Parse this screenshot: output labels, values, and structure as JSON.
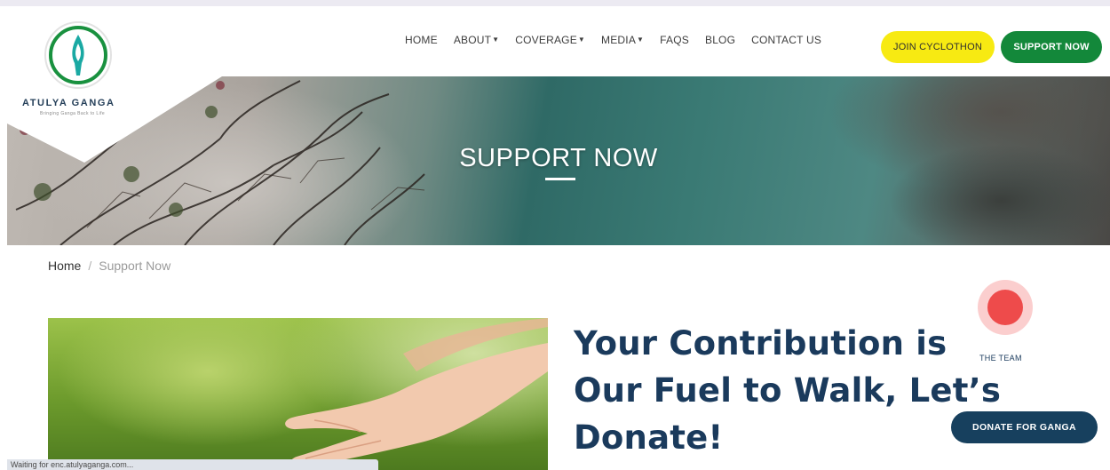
{
  "nav": {
    "items": [
      {
        "label": "HOME",
        "has_dropdown": false
      },
      {
        "label": "ABOUT",
        "has_dropdown": true
      },
      {
        "label": "COVERAGE",
        "has_dropdown": true
      },
      {
        "label": "MEDIA",
        "has_dropdown": true
      },
      {
        "label": "FAQS",
        "has_dropdown": false
      },
      {
        "label": "BLOG",
        "has_dropdown": false
      },
      {
        "label": "CONTACT US",
        "has_dropdown": false
      }
    ],
    "join_label": "JOIN CYCLOTHON",
    "support_label": "SUPPORT NOW"
  },
  "logo": {
    "name": "ATULYA GANGA",
    "tagline": "Bringing Ganga Back to Life",
    "icon": "flame-drop-icon"
  },
  "hero": {
    "title": "SUPPORT NOW"
  },
  "breadcrumb": {
    "home": "Home",
    "separator": "/",
    "current": "Support Now"
  },
  "main": {
    "heading_lines": [
      "Your Contribution is",
      "Our Fuel to Walk, Let’s",
      "Donate!"
    ]
  },
  "floating": {
    "team_label": "THE TEAM",
    "donate_label": "DONATE FOR GANGA"
  },
  "statusbar": {
    "text": "Waiting for enc.atulyaganga.com..."
  },
  "colors": {
    "brand_green": "#13883a",
    "join_yellow": "#f7ea12",
    "navy": "#17405e",
    "heading": "#1a3a5c",
    "alert_red": "#ee4b4b"
  }
}
